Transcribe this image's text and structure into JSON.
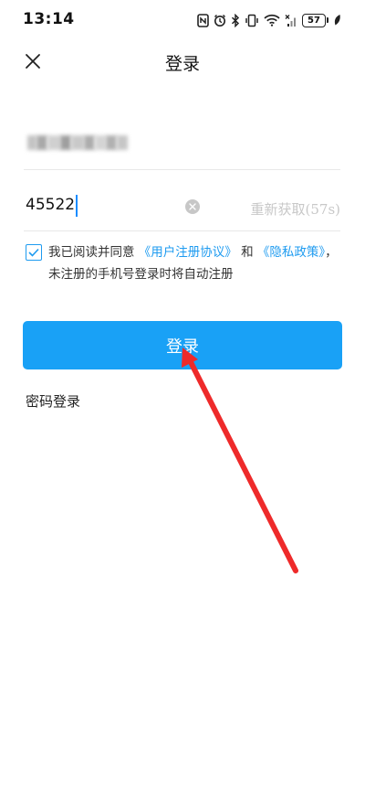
{
  "status_bar": {
    "time": "13:14",
    "battery_level": "57",
    "icons": [
      "nfc-icon",
      "alarm-icon",
      "bluetooth-icon",
      "vibrate-icon",
      "wifi-icon",
      "no-signal-icon",
      "battery-icon",
      "leaf-icon"
    ]
  },
  "header": {
    "title": "登录",
    "close_icon": "close-icon"
  },
  "phone_field": {
    "value_state": "blurred"
  },
  "code_field": {
    "value": "45522",
    "resend_label": "重新获取(57s)"
  },
  "agreement": {
    "checked": true,
    "text_1": "我已阅读并同意",
    "link_user_agreement": "《用户注册协议》",
    "text_2": "和",
    "link_privacy_a": "《隐私政",
    "link_privacy_b": "策》",
    "text_3": "，未注册的手机号登录时将自动注册"
  },
  "login_button": {
    "label": "登录"
  },
  "password_login": {
    "label": "密码登录"
  },
  "colors": {
    "accent": "#19a1f6",
    "link": "#1e9bf0",
    "annotation_arrow": "#ee2a2a"
  }
}
